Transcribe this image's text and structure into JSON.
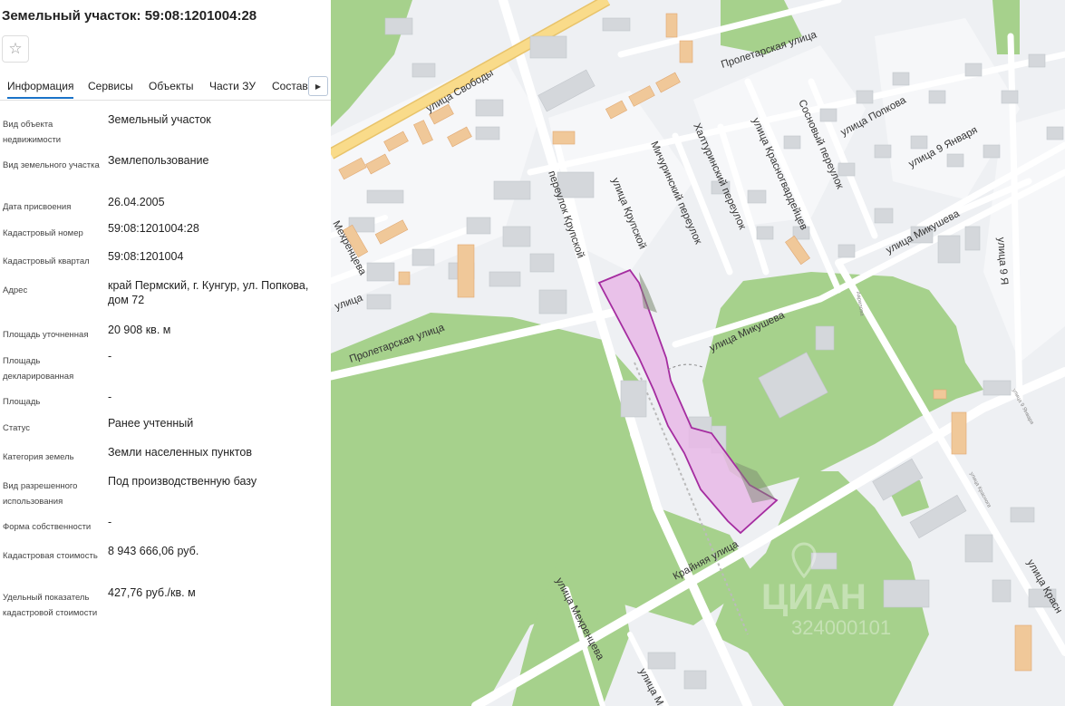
{
  "panel": {
    "title": "Земельный участок: 59:08:1201004:28",
    "tabs": [
      "Информация",
      "Сервисы",
      "Объекты",
      "Части ЗУ",
      "Состав"
    ],
    "rows": [
      {
        "label": "Вид объекта недвижимости",
        "value": "Земельный участок"
      },
      {
        "label": "Вид земельного участка",
        "value": "Землепользование"
      },
      {
        "label": "Дата присвоения",
        "value": "26.04.2005"
      },
      {
        "label": "Кадастровый номер",
        "value": "59:08:1201004:28"
      },
      {
        "label": "Кадастровый квартал",
        "value": "59:08:1201004"
      },
      {
        "label": "Адрес",
        "value": "край Пермский, г. Кунгур, ул. Попкова, дом 72"
      },
      {
        "label": "Площадь уточненная",
        "value": "20 908 кв. м"
      },
      {
        "label": "Площадь декларированная",
        "value": "-"
      },
      {
        "label": "Площадь",
        "value": "-"
      },
      {
        "label": "Статус",
        "value": "Ранее учтенный"
      },
      {
        "label": "Категория земель",
        "value": "Земли населенных пунктов"
      },
      {
        "label": "Вид разрешенного использования",
        "value": "Под производственную базу"
      },
      {
        "label": "Форма собственности",
        "value": "-"
      },
      {
        "label": "Кадастровая стоимость",
        "value": "8 943 666,06 руб."
      },
      {
        "label": "Удельный показатель кадастровой стоимости",
        "value": "427,76 руб./кв. м"
      }
    ]
  },
  "map": {
    "streets": {
      "svobody": "улица Свободы",
      "proletarskaya_top": "Пролетарская улица",
      "proletarskaya_left": "Пролетарская улица",
      "krupskoy_lane": "переулок Крупской",
      "krupskoy_st": "улица Крупской",
      "michurinsky": "Мичуринский переулок",
      "khaltur": "Халтуринский переулок",
      "krasnogv": "улица Красногвардейцев",
      "sosnovy": "Сосновый переулок",
      "popkova": "улица Попкова",
      "yanvarya": "улица 9 Января",
      "mikusheva_top": "улица Микушева",
      "mikusheva_mid": "улица Микушева",
      "krainyaya": "Крайняя улица",
      "mekhrentseva": "улица Мехренцева",
      "mekhrentseva_top": "Мехренцева",
      "left_street": "улица",
      "yanv_right": "улица 9 Я",
      "krasn_right": "улица Красн",
      "bottom_street": "улица М",
      "krasn_small": "улица Красногв",
      "yanv_small": "улица 9 Января",
      "gavrilova": "Аврилова"
    },
    "watermark": {
      "brand": "ЦИАН",
      "code": "324000101"
    },
    "colors": {
      "parcel_fill": "#e7b8e6",
      "parcel_stroke": "#a52ca0",
      "park": "#a6d18c",
      "building": "#d4d7db",
      "industrial": "#f0c899",
      "road_major": "#f9db8a"
    }
  }
}
